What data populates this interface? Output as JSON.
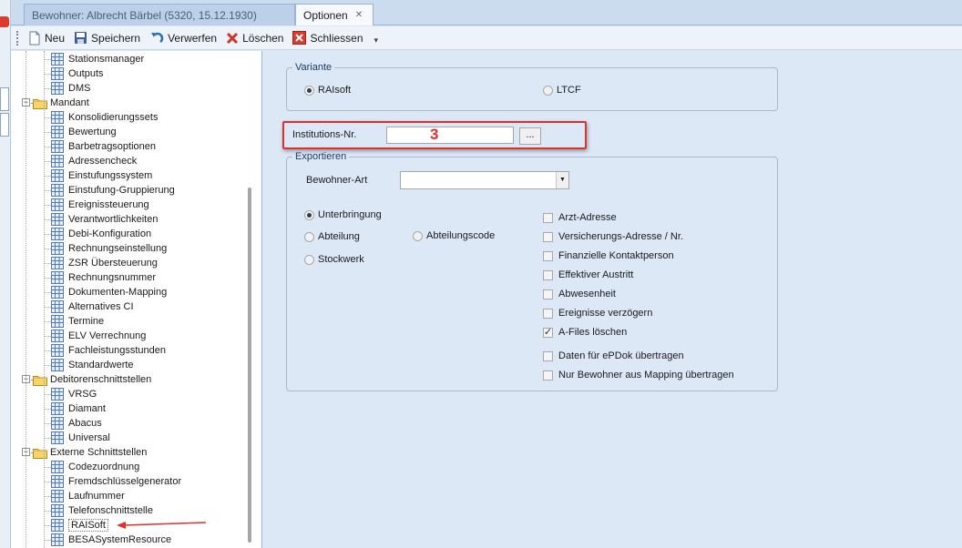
{
  "tabs": [
    {
      "label": "Bewohner: Albrecht Bärbel (5320, 15.12.1930)",
      "active": false
    },
    {
      "label": "Optionen",
      "active": true
    }
  ],
  "toolbar": {
    "new_label": "Neu",
    "save_label": "Speichern",
    "discard_label": "Verwerfen",
    "delete_label": "Löschen",
    "close_label": "Schliessen"
  },
  "tree": {
    "groups": [
      {
        "label": null,
        "items": [
          "Stationsmanager",
          "Outputs",
          "DMS"
        ]
      },
      {
        "label": "Mandant",
        "items": [
          "Konsolidierungssets",
          "Bewertung",
          "Barbetragsoptionen",
          "Adressencheck",
          "Einstufungssystem",
          "Einstufung-Gruppierung",
          "Ereignissteuerung",
          "Verantwortlichkeiten",
          "Debi-Konfiguration",
          "Rechnungseinstellung",
          "ZSR Übersteuerung",
          "Rechnungsnummer",
          "Dokumenten-Mapping",
          "Alternatives CI",
          "Termine",
          "ELV Verrechnung",
          "Fachleistungsstunden",
          "Standardwerte"
        ]
      },
      {
        "label": "Debitorenschnittstellen",
        "items": [
          "VRSG",
          "Diamant",
          "Abacus",
          "Universal"
        ]
      },
      {
        "label": "Externe Schnittstellen",
        "items": [
          "Codezuordnung",
          "Fremdschlüsselgenerator",
          "Laufnummer",
          "Telefonschnittstelle",
          "RAISoft",
          "BESASystemResource"
        ]
      }
    ]
  },
  "variante": {
    "legend": "Variante",
    "options": [
      "RAIsoft",
      "LTCF"
    ],
    "selected": "RAIsoft"
  },
  "institution": {
    "label": "Institutions-Nr.",
    "value": "",
    "browse_label": "...",
    "annotation": "3"
  },
  "export": {
    "legend": "Exportieren",
    "bewohner_art_label": "Bewohner-Art",
    "bewohner_art_value": "",
    "radios": [
      "Unterbringung",
      "Abteilung",
      "Abteilungscode",
      "Stockwerk"
    ],
    "radio_selected": "Unterbringung",
    "checkboxes": [
      {
        "label": "Arzt-Adresse",
        "checked": false
      },
      {
        "label": "Versicherungs-Adresse / Nr.",
        "checked": false
      },
      {
        "label": "Finanzielle Kontaktperson",
        "checked": false
      },
      {
        "label": "Effektiver Austritt",
        "checked": false
      },
      {
        "label": "Abwesenheit",
        "checked": false
      },
      {
        "label": "Ereignisse verzögern",
        "checked": false
      },
      {
        "label": "A-Files löschen",
        "checked": true
      },
      {
        "label": "Daten für ePDok übertragen",
        "checked": false
      },
      {
        "label": "Nur Bewohner aus Mapping übertragen",
        "checked": false
      }
    ]
  },
  "colors": {
    "accent_red": "#e0302a",
    "panel_bg": "#dce8f6"
  }
}
